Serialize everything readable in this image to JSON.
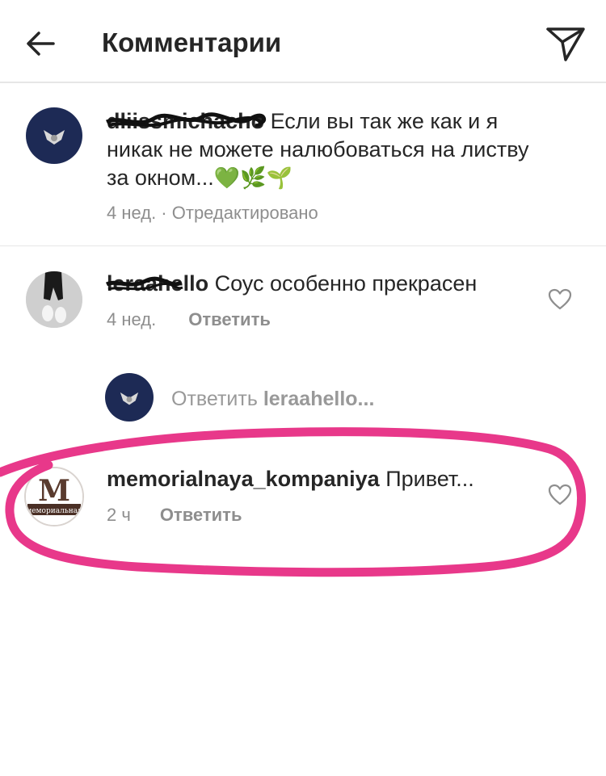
{
  "header": {
    "title": "Комментарии"
  },
  "caption": {
    "username": "dliissmichacho",
    "text": "Если вы так же как и я никак не можете налюбоваться на листву за окном...",
    "emojis": "💚🌿🌱",
    "meta": "4 нед. · Отредактировано"
  },
  "comments": [
    {
      "username": "leraahello",
      "text": "Соус особенно прекрасен",
      "time": "4 нед.",
      "reply_label": "Ответить"
    },
    {
      "username": "memorialnaya_kompaniya",
      "text": "Привет...",
      "time": "2 ч",
      "reply_label": "Ответить",
      "avatar_text": "мемориальная",
      "avatar_letter": "M"
    }
  ],
  "reply_box": {
    "prefix": "Ответить",
    "target": "leraahello..."
  },
  "colors": {
    "text": "#262626",
    "muted": "#8e8e8e",
    "highlight": "#e8388a",
    "avatar_navy": "#1d2a55"
  },
  "icons": {
    "back": "arrow-left-icon",
    "share": "paper-plane-icon",
    "like": "heart-outline-icon"
  }
}
